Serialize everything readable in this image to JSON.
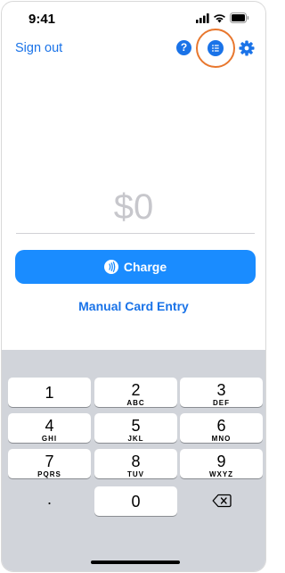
{
  "status_bar": {
    "time": "9:41"
  },
  "nav": {
    "sign_out_label": "Sign out",
    "help_label": "?"
  },
  "amount": {
    "value": "$0"
  },
  "actions": {
    "charge_label": "Charge",
    "manual_entry_label": "Manual Card Entry"
  },
  "keypad": {
    "keys": [
      {
        "num": "1",
        "letters": ""
      },
      {
        "num": "2",
        "letters": "ABC"
      },
      {
        "num": "3",
        "letters": "DEF"
      },
      {
        "num": "4",
        "letters": "GHI"
      },
      {
        "num": "5",
        "letters": "JKL"
      },
      {
        "num": "6",
        "letters": "MNO"
      },
      {
        "num": "7",
        "letters": "PQRS"
      },
      {
        "num": "8",
        "letters": "TUV"
      },
      {
        "num": "9",
        "letters": "WXYZ"
      },
      {
        "num": ".",
        "letters": ""
      },
      {
        "num": "0",
        "letters": ""
      },
      {
        "num": "",
        "letters": ""
      }
    ]
  },
  "colors": {
    "accent": "#1a73e8",
    "charge_button": "#1a8cff",
    "highlight_ring": "#e8772e",
    "keypad_background": "#d1d4da"
  },
  "icons": [
    "signal-icon",
    "wifi-icon",
    "battery-icon",
    "help-icon",
    "list-icon",
    "gear-icon",
    "contactless-icon",
    "backspace-icon"
  ]
}
